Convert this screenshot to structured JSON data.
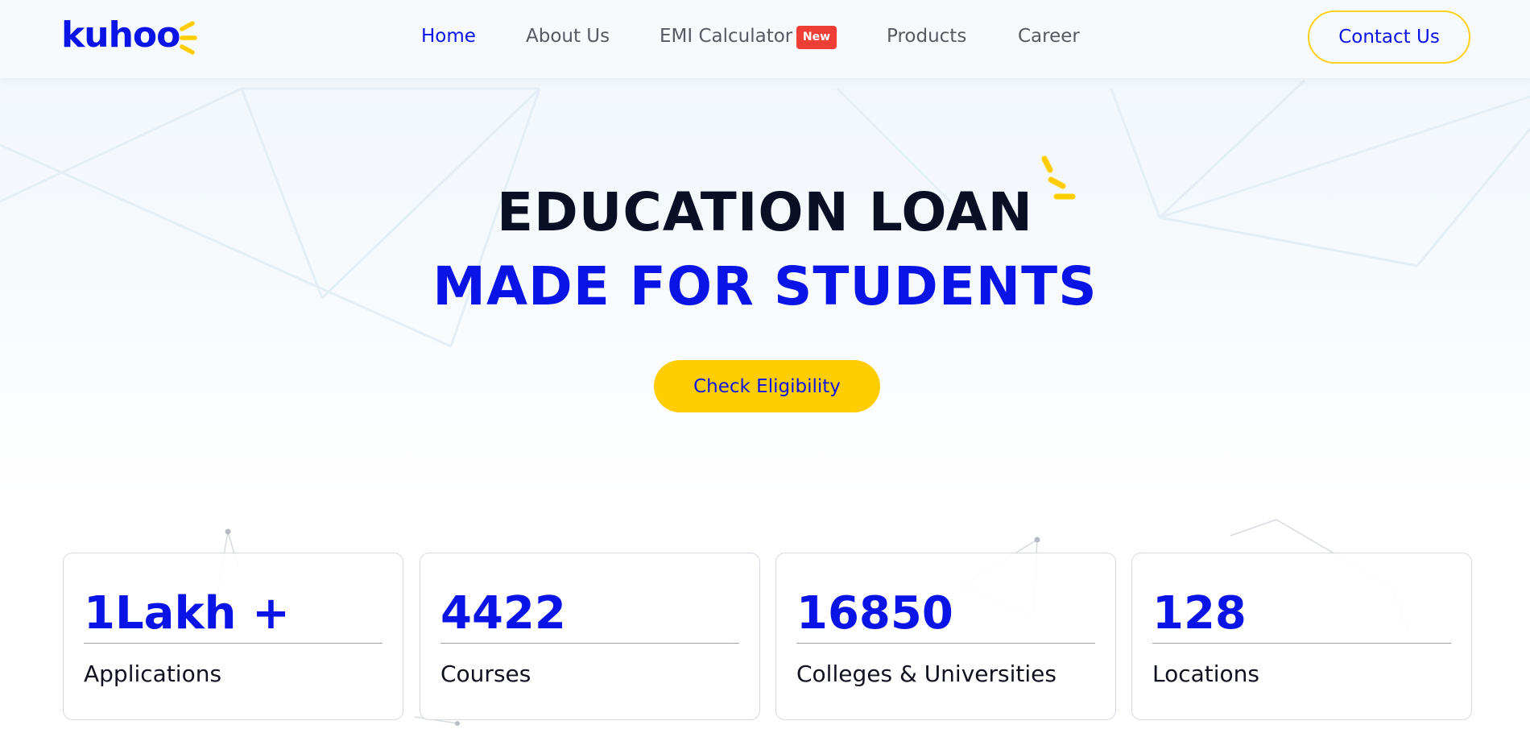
{
  "brand": {
    "name": "kuhoo",
    "accent": "#0a14e6",
    "highlight": "#ffcd00",
    "badge_color": "#ef3e36"
  },
  "nav": {
    "items": [
      {
        "label": "Home",
        "active": true
      },
      {
        "label": "About Us"
      },
      {
        "label": "EMI Calculator",
        "badge": "New"
      },
      {
        "label": "Products"
      },
      {
        "label": "Career"
      }
    ],
    "contact_label": "Contact Us"
  },
  "hero": {
    "line1": "EDUCATION LOAN",
    "line2": "MADE FOR STUDENTS",
    "cta_label": "Check Eligibility"
  },
  "stats": [
    {
      "value": "1Lakh +",
      "label": "Applications"
    },
    {
      "value": "4422",
      "label": "Courses"
    },
    {
      "value": "16850",
      "label": "Colleges & Universities"
    },
    {
      "value": "128",
      "label": "Locations"
    }
  ]
}
